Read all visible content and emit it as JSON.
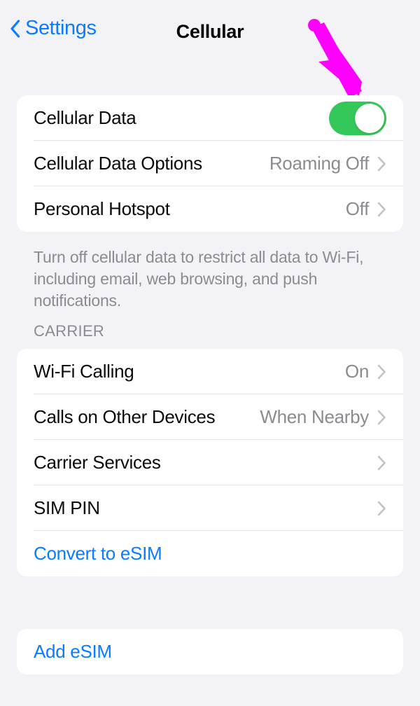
{
  "navbar": {
    "back_label": "Settings",
    "back_icon": "chevron-left-icon",
    "title": "Cellular"
  },
  "annotation": {
    "arrow_icon": "arrow-down-right-icon",
    "color": "#ff00ff",
    "points_to": "cellular-data-toggle"
  },
  "colors": {
    "background": "#f2f2f7",
    "card": "#ffffff",
    "accent_blue": "#0a7cff",
    "toggle_on_green": "#34c759",
    "secondary_text": "#8b8b90",
    "separator": "#e3e3e6",
    "annotation_magenta": "#ff00ff"
  },
  "data_section": {
    "rows": [
      {
        "label": "Cellular Data",
        "control": "toggle",
        "toggle_state": "on",
        "value": "",
        "chevron": false
      },
      {
        "label": "Cellular Data Options",
        "control": "disclosure",
        "value": "Roaming Off",
        "chevron": true
      },
      {
        "label": "Personal Hotspot",
        "control": "disclosure",
        "value": "Off",
        "chevron": true
      }
    ],
    "footer": "Turn off cellular data to restrict all data to Wi-Fi, including email, web browsing, and push notifications."
  },
  "carrier_section": {
    "header": "CARRIER",
    "rows": [
      {
        "label": "Wi-Fi Calling",
        "control": "disclosure",
        "value": "On",
        "chevron": true
      },
      {
        "label": "Calls on Other Devices",
        "control": "disclosure",
        "value": "When Nearby",
        "chevron": true
      },
      {
        "label": "Carrier Services",
        "control": "disclosure",
        "value": "",
        "chevron": true
      },
      {
        "label": "SIM PIN",
        "control": "disclosure",
        "value": "",
        "chevron": true
      },
      {
        "label": "Convert to eSIM",
        "control": "link",
        "value": "",
        "chevron": false
      }
    ]
  },
  "add_section": {
    "rows": [
      {
        "label": "Add eSIM",
        "control": "link",
        "value": "",
        "chevron": false
      }
    ]
  }
}
